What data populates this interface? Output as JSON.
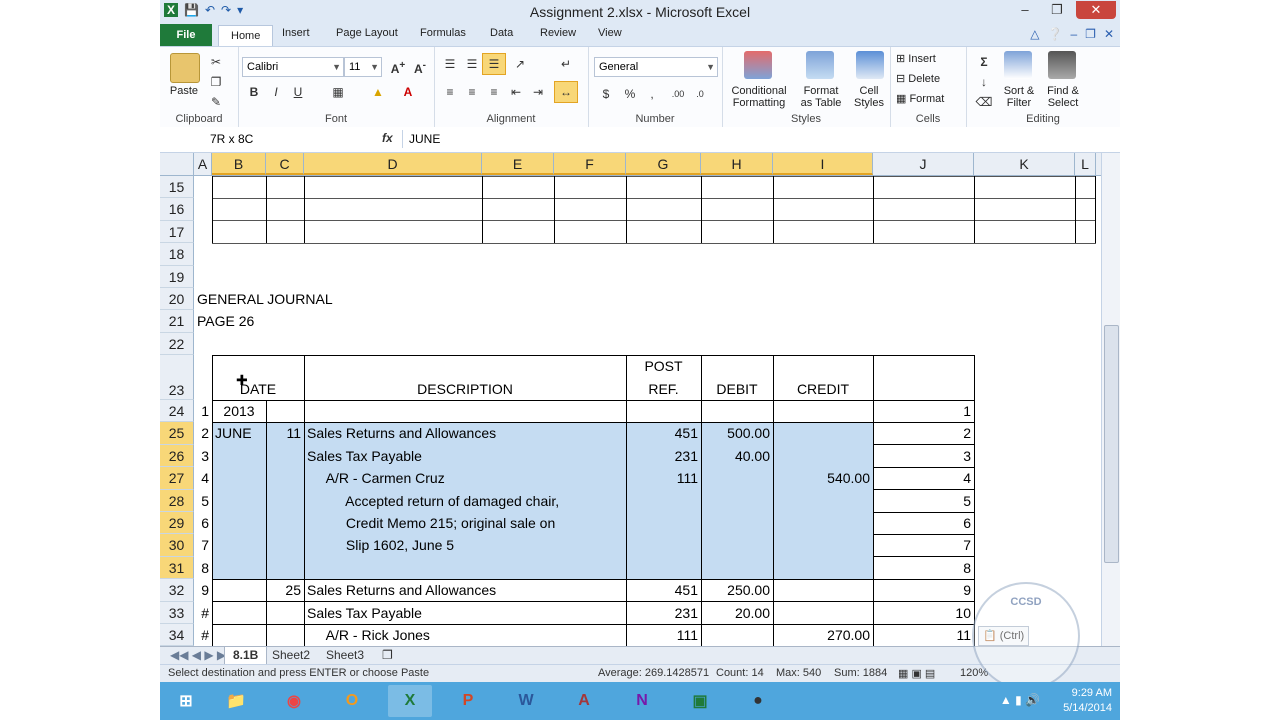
{
  "window": {
    "title": "Assignment 2.xlsx  -  Microsoft Excel"
  },
  "ribbon_tabs": [
    "File",
    "Home",
    "Insert",
    "Page Layout",
    "Formulas",
    "Data",
    "Review",
    "View"
  ],
  "clipboard": {
    "paste": "Paste",
    "label": "Clipboard"
  },
  "font": {
    "name": "Calibri",
    "size": "11",
    "label": "Font"
  },
  "alignment": {
    "label": "Alignment"
  },
  "number": {
    "format": "General",
    "label": "Number"
  },
  "styles": {
    "conditional": "Conditional",
    "conditional2": "Formatting",
    "format_table": "Format",
    "format_table2": "as Table",
    "cell_styles": "Cell",
    "cell_styles2": "Styles",
    "label": "Styles"
  },
  "cells": {
    "insert": "Insert",
    "delete": "Delete",
    "format": "Format",
    "label": "Cells"
  },
  "editing": {
    "sort": "Sort &",
    "sort2": "Filter",
    "find": "Find &",
    "find2": "Select",
    "label": "Editing"
  },
  "formula_bar": {
    "name_box": "7R x 8C",
    "fx": "fx",
    "content": "JUNE"
  },
  "columns": [
    "A",
    "B",
    "C",
    "D",
    "E",
    "F",
    "G",
    "H",
    "I",
    "J",
    "K",
    "L"
  ],
  "rows": {
    "r15": "15",
    "r16": "16",
    "r17": "17",
    "r18": "18",
    "r19": "19",
    "r20": "20",
    "r21": "21",
    "r22": "22",
    "r23": "23",
    "r24": "24",
    "r25": "25",
    "r26": "26",
    "r27": "27",
    "r28": "28",
    "r29": "29",
    "r30": "30",
    "r31": "31",
    "r32": "32",
    "r33": "33",
    "r34": "34"
  },
  "journal": {
    "heading": "GENERAL JOURNAL",
    "page": "PAGE 26",
    "col_date": "DATE",
    "col_desc": "DESCRIPTION",
    "col_post1": "POST",
    "col_post2": "REF.",
    "col_debit": "DEBIT",
    "col_credit": "CREDIT",
    "lines": [
      {
        "num": "1",
        "b": "2013",
        "c": "",
        "d": "",
        "g": "",
        "h": "",
        "i": "",
        "j": "1"
      },
      {
        "num": "2",
        "b": "JUNE",
        "c": "11",
        "d": "Sales Returns and Allowances",
        "g": "451",
        "h": "500.00",
        "i": "",
        "j": "2"
      },
      {
        "num": "3",
        "b": "",
        "c": "",
        "d": "Sales Tax Payable",
        "g": "231",
        "h": "40.00",
        "i": "",
        "j": "3"
      },
      {
        "num": "4",
        "b": "",
        "c": "",
        "d": "     A/R - Carmen Cruz",
        "g": "111",
        "h": "",
        "i": "540.00",
        "j": "4"
      },
      {
        "num": "5",
        "b": "",
        "c": "",
        "d": "          Accepted return of damaged chair,",
        "g": "",
        "h": "",
        "i": "",
        "j": "5"
      },
      {
        "num": "6",
        "b": "",
        "c": "",
        "d": "          Credit Memo 215; original sale on",
        "g": "",
        "h": "",
        "i": "",
        "j": "6"
      },
      {
        "num": "7",
        "b": "",
        "c": "",
        "d": "          Slip 1602, June 5",
        "g": "",
        "h": "",
        "i": "",
        "j": "7"
      },
      {
        "num": "8",
        "b": "",
        "c": "",
        "d": "",
        "g": "",
        "h": "",
        "i": "",
        "j": "8"
      },
      {
        "num": "9",
        "b": "",
        "c": "25",
        "d": "Sales Returns and Allowances",
        "g": "451",
        "h": "250.00",
        "i": "",
        "j": "9"
      },
      {
        "num": "#",
        "b": "",
        "c": "",
        "d": "Sales Tax Payable",
        "g": "231",
        "h": "20.00",
        "i": "",
        "j": "10"
      },
      {
        "num": "#",
        "b": "",
        "c": "",
        "d": "     A/R - Rick Jones",
        "g": "111",
        "h": "",
        "i": "270.00",
        "j": "11"
      }
    ]
  },
  "sheets": [
    "8.1B",
    "Sheet2",
    "Sheet3"
  ],
  "status": {
    "message": "Select destination and press ENTER or choose Paste",
    "average": "Average: 269.1428571",
    "count": "Count: 14",
    "max": "Max: 540",
    "sum": "Sum: 1884",
    "zoom": "120%"
  },
  "paste_options": "(Ctrl)",
  "watermark": "CCSD",
  "clock": {
    "time": "9:29 AM",
    "date": "5/14/2014"
  },
  "colors": {
    "selection": "#c5dcf2",
    "header_selected": "#f8d778",
    "file_tab": "#1f7a3a",
    "taskbar": "#4fa6dd"
  }
}
